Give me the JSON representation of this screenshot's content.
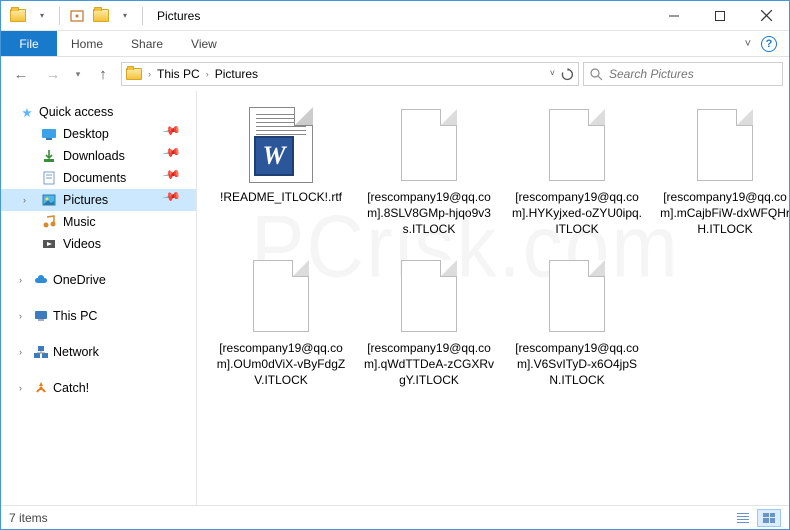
{
  "window": {
    "title": "Pictures"
  },
  "ribbon": {
    "file": "File",
    "tabs": [
      "Home",
      "Share",
      "View"
    ]
  },
  "breadcrumb": {
    "root": "This PC",
    "current": "Pictures"
  },
  "search": {
    "placeholder": "Search Pictures"
  },
  "sidebar": {
    "quick_access": {
      "label": "Quick access",
      "items": [
        {
          "label": "Desktop",
          "pinned": true
        },
        {
          "label": "Downloads",
          "pinned": true
        },
        {
          "label": "Documents",
          "pinned": true
        },
        {
          "label": "Pictures",
          "pinned": true,
          "selected": true
        },
        {
          "label": "Music",
          "pinned": false
        },
        {
          "label": "Videos",
          "pinned": false
        }
      ]
    },
    "roots": [
      {
        "label": "OneDrive",
        "icon": "cloud"
      },
      {
        "label": "This PC",
        "icon": "pc"
      },
      {
        "label": "Network",
        "icon": "network"
      },
      {
        "label": "Catch!",
        "icon": "catch"
      }
    ]
  },
  "files": [
    {
      "name": "!README_ITLOCK!.rtf",
      "type": "rtf"
    },
    {
      "name": "[rescompany19@qq.com].8SLV8GMp-hjqo9v3s.ITLOCK",
      "type": "blank"
    },
    {
      "name": "[rescompany19@qq.com].HYKyjxed-oZYU0ipq.ITLOCK",
      "type": "blank"
    },
    {
      "name": "[rescompany19@qq.com].mCajbFiW-dxWFQHrH.ITLOCK",
      "type": "blank"
    },
    {
      "name": "[rescompany19@qq.com].OUm0dViX-vByFdgZV.ITLOCK",
      "type": "blank"
    },
    {
      "name": "[rescompany19@qq.com].qWdTTDeA-zCGXRvgY.ITLOCK",
      "type": "blank"
    },
    {
      "name": "[rescompany19@qq.com].V6SvITyD-x6O4jpSN.ITLOCK",
      "type": "blank"
    }
  ],
  "status": {
    "count_label": "7 items"
  },
  "watermark": "PCrisk.com"
}
